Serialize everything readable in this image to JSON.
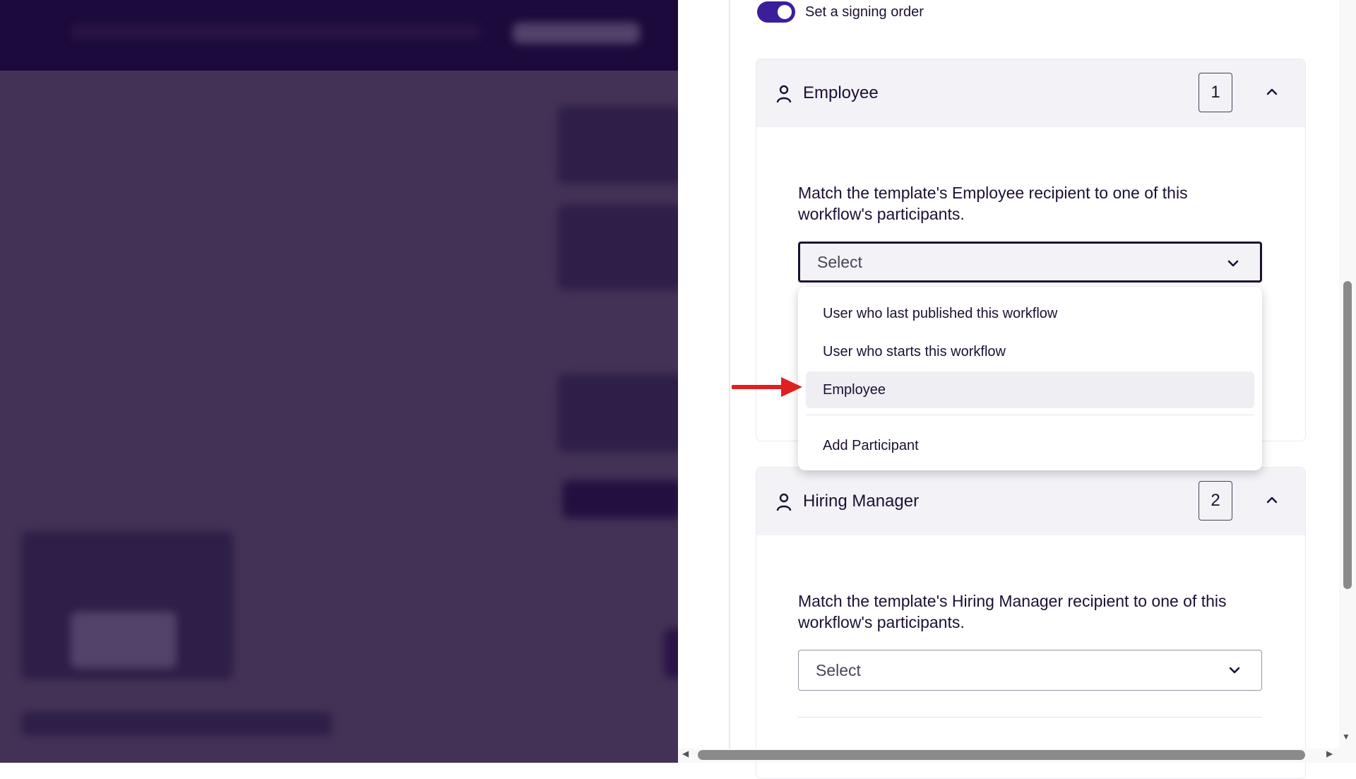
{
  "signing_order": {
    "label": "Set a signing order",
    "enabled": true,
    "accent_color": "#3b1f9a"
  },
  "recipients": [
    {
      "title": "Employee",
      "order": "1",
      "match_text": "Match the template's Employee recipient to one of this workflow's participants.",
      "select_value": "Select"
    },
    {
      "title": "Hiring Manager",
      "order": "2",
      "match_text": "Match the template's Hiring Manager recipient to one of this workflow's participants.",
      "select_value": "Select"
    }
  ],
  "dropdown": {
    "options": [
      "User who last published this workflow",
      "User who starts this workflow",
      "Employee"
    ],
    "highlighted": "Employee",
    "add_action": "Add Participant"
  },
  "icons": {
    "person": "person-icon",
    "collapse": "chevron-up-icon",
    "select": "chevron-down-icon",
    "annotation": "red-arrow-icon"
  },
  "colors": {
    "text": "#1d1033",
    "annotation_arrow": "#e02020",
    "overlay": "#433256"
  }
}
